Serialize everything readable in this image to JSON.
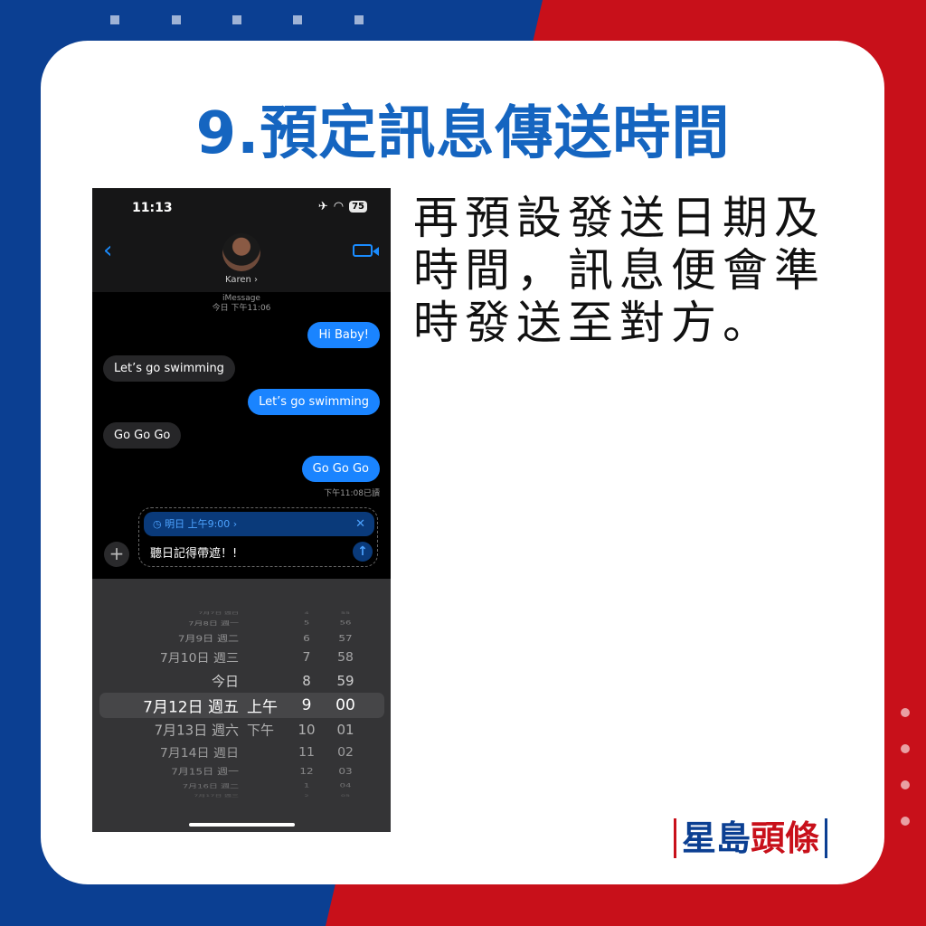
{
  "title": "9.預定訊息傳送時間",
  "description": "再預設發送日期及時間，訊息便會準時發送至對方。",
  "colors": {
    "blue": "#0b3f92",
    "red": "#c8101a",
    "title": "#1565c0",
    "imessage_blue": "#1a84ff"
  },
  "phone": {
    "status": {
      "time": "11:13",
      "battery": "75",
      "icons": [
        "airplane-icon",
        "wifi-icon",
        "battery-icon"
      ]
    },
    "nav": {
      "back": "‹",
      "contact": "Karen ›"
    },
    "meta": {
      "service": "iMessage",
      "timestamp": "今日 下午11:06"
    },
    "messages": [
      {
        "from": "me",
        "text": "Hi Baby!"
      },
      {
        "from": "them",
        "text": "Let’s go swimming"
      },
      {
        "from": "me",
        "text": "Let’s go swimming"
      },
      {
        "from": "them",
        "text": "Go Go Go"
      },
      {
        "from": "me",
        "text": "Go Go Go"
      }
    ],
    "read_receipt": "下午11:08已讀",
    "compose": {
      "schedule": "明日 上午9:00 ›",
      "close": "✕",
      "text": "聽日記得帶遮！!",
      "plus": "+",
      "send": "↑"
    },
    "picker": {
      "rows": [
        {
          "date": "7月7日 週日",
          "ampm": "",
          "hour": "4",
          "minute": "55"
        },
        {
          "date": "7月8日 週一",
          "ampm": "",
          "hour": "5",
          "minute": "56"
        },
        {
          "date": "7月9日 週二",
          "ampm": "",
          "hour": "6",
          "minute": "57"
        },
        {
          "date": "7月10日 週三",
          "ampm": "",
          "hour": "7",
          "minute": "58"
        },
        {
          "date": "今日",
          "ampm": "",
          "hour": "8",
          "minute": "59"
        },
        {
          "date": "7月12日 週五",
          "ampm": "上午",
          "hour": "9",
          "minute": "00",
          "selected": true
        },
        {
          "date": "7月13日 週六",
          "ampm": "下午",
          "hour": "10",
          "minute": "01"
        },
        {
          "date": "7月14日 週日",
          "ampm": "",
          "hour": "11",
          "minute": "02"
        },
        {
          "date": "7月15日 週一",
          "ampm": "",
          "hour": "12",
          "minute": "03"
        },
        {
          "date": "7月16日 週二",
          "ampm": "",
          "hour": "1",
          "minute": "04"
        },
        {
          "date": "7月17日 週三",
          "ampm": "",
          "hour": "2",
          "minute": "05"
        }
      ]
    }
  },
  "logo": {
    "part1": "星島",
    "part2": "頭條"
  }
}
